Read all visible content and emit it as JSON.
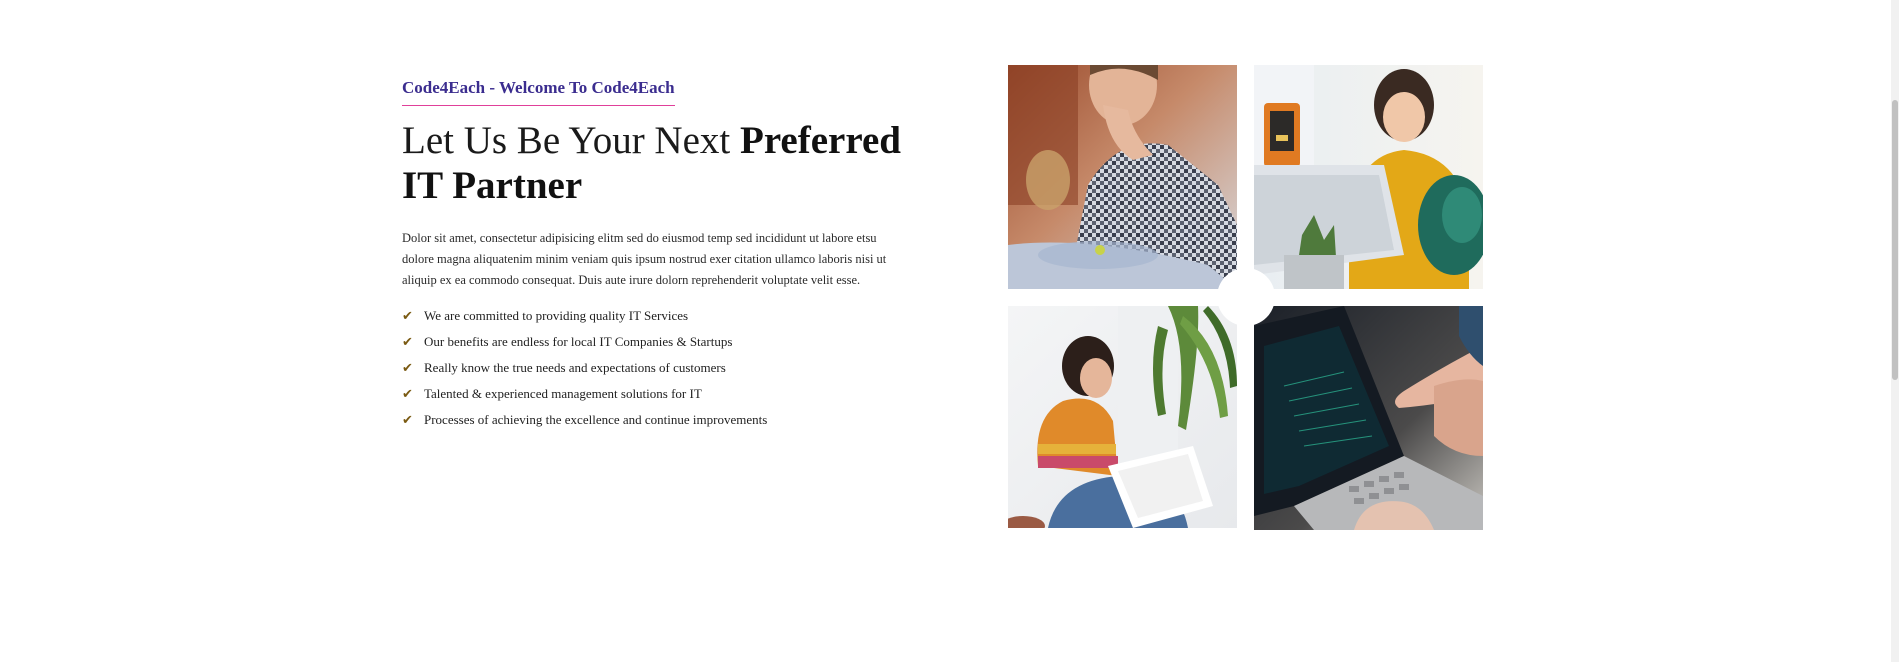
{
  "about": {
    "subtitle": "Code4Each - Welcome To Code4Each",
    "heading_light": "Let Us Be Your Next ",
    "heading_bold_1": "Preferred",
    "heading_bold_2": "IT Partner",
    "description": "Dolor sit amet, consectetur adipisicing elitm sed do eiusmod temp sed incididunt ut labore etsu dolore magna aliquatenim minim veniam quis ipsum nostrud exer citation ullamco laboris nisi ut aliquip ex ea commodo consequat. Duis aute irure dolorn reprehenderit voluptate velit esse.",
    "features": [
      "We are committed to providing quality IT Services",
      "Our benefits are endless for local IT Companies & Startups",
      "Really know the true needs and expectations of customers",
      "Talented & experienced management solutions for IT",
      "Processes of achieving the excellence and continue improvements"
    ],
    "check_icon": "check-icon"
  },
  "gallery": {
    "images": [
      "office-man-thinking-photo",
      "woman-laptop-smiling-photo",
      "woman-reading-papers-photo",
      "hands-pointing-laptop-photo"
    ]
  },
  "colors": {
    "subtitle": "#3b2d8f",
    "subtitle_underline": "#e0409a",
    "check": "#7a5a12"
  }
}
